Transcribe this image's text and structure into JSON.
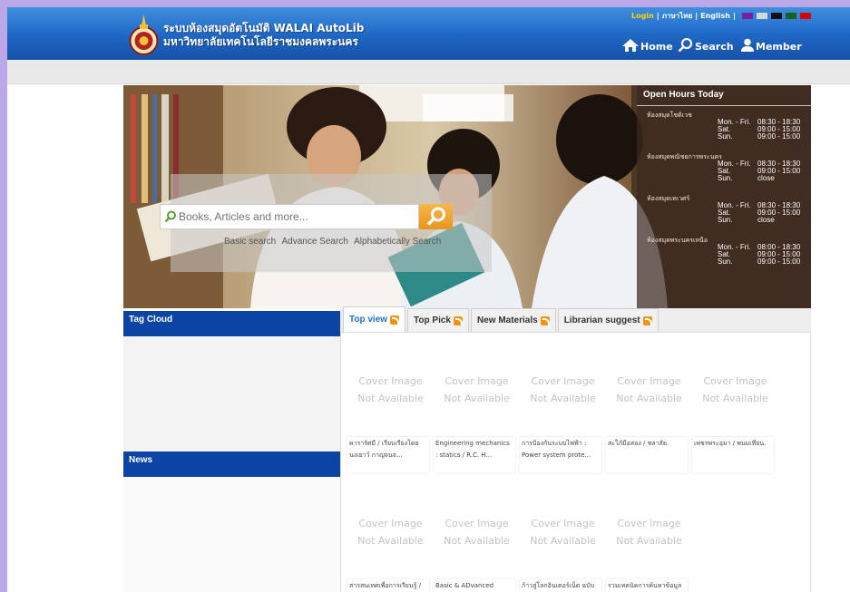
{
  "header": {
    "title_line1": "ระบบห้องสมุดอัตโนมัติ WALAI AutoLib",
    "title_line2": "มหาวิทยาลัยเทคโนโลยีราชมงคลพระนคร",
    "login": "Login",
    "lang_thai": "ภาษาไทย",
    "lang_english": "English",
    "theme_colors": [
      "#7b1fa2",
      "#cfd8dc",
      "#111111",
      "#1b5e20",
      "#d50000"
    ],
    "nav": {
      "home": "Home",
      "search": "Search",
      "member": "Member"
    }
  },
  "search": {
    "placeholder": "Books, Articles and more...",
    "basic": "Basic search",
    "advance": "Advance Search",
    "alpha": "Alphabetically Search"
  },
  "hours": {
    "title": "Open Hours Today",
    "libraries": [
      {
        "name": "ห้องสมุดโชติเวช",
        "rows": [
          [
            "Mon. - Fri.",
            "08:30 - 18:30"
          ],
          [
            "Sat.",
            "09:00 - 15:00"
          ],
          [
            "Sun.",
            "09:00 - 15:00"
          ]
        ]
      },
      {
        "name": "ห้องสมุดพณิชยการพระนคร",
        "rows": [
          [
            "Mon. - Fri.",
            "08:30 - 18:30"
          ],
          [
            "Sat.",
            "09:00 - 15:00"
          ],
          [
            "Sun.",
            "close"
          ]
        ]
      },
      {
        "name": "ห้องสมุดเทเวศร์",
        "rows": [
          [
            "Mon. - Fri.",
            "08:30 - 18:30"
          ],
          [
            "Sat.",
            "09:00 - 15:00"
          ],
          [
            "Sun.",
            "close"
          ]
        ]
      },
      {
        "name": "ห้องสมุดพระนครเหนือ",
        "rows": [
          [
            "Mon. - Fri.",
            "08:00 - 18:30"
          ],
          [
            "Sat.",
            "09:00 - 15:00"
          ],
          [
            "Sun.",
            "09:00 - 15:00"
          ]
        ]
      }
    ]
  },
  "sidebar": {
    "tag_cloud": "Tag Cloud",
    "news": "News"
  },
  "tabs": [
    {
      "label": "Top view"
    },
    {
      "label": "Top Pick"
    },
    {
      "label": "New Materials"
    },
    {
      "label": "Librarian suggest"
    }
  ],
  "cover_placeholder": {
    "line1": "Cover Image",
    "line2": "Not Available"
  },
  "books_row1": [
    {
      "title": "ดารารัศมี / เรียบเรียงโดย นงเยาว์ กาญจนจ..."
    },
    {
      "title": "Engineering mechanics : statics / R.C. H..."
    },
    {
      "title": "การป้องกันระบบไฟฟ้า : Power system prote..."
    },
    {
      "title": "สะใภ้มือสอง / ชลาลัย."
    },
    {
      "title": "เพชรพระอุมา / พนมเทียน."
    }
  ],
  "books_row2": [
    {
      "title": "สารสนเทศเพื่อการเรียนรู้ /"
    },
    {
      "title": "Basic & ADvanced"
    },
    {
      "title": "ก้าวสู่โลกอินเตอร์เน็ต ฉบับ"
    },
    {
      "title": "รวมเทคนิคการค้นหาข้อมูล"
    }
  ]
}
